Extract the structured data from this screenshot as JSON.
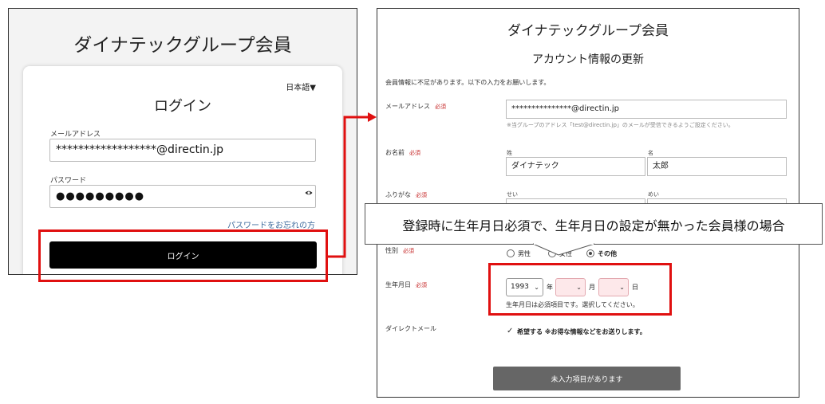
{
  "login_screen": {
    "title": "ダイナテックグループ会員",
    "language_selector": "日本語▼",
    "heading": "ログイン",
    "email_label": "メールアドレス",
    "email_value": "******************@directin.jp",
    "password_label": "パスワード",
    "password_value": "●●●●●●●●●",
    "forgot_password_link": "パスワードをお忘れの方",
    "login_button": "ログイン"
  },
  "update_screen": {
    "title": "ダイナテックグループ会員",
    "heading": "アカウント情報の更新",
    "notice": "会員情報に不足があります。以下の入力をお願いします。",
    "required_badge": "必須",
    "email": {
      "label": "メールアドレス",
      "value": "***************@directin.jp",
      "hint": "※当グループのアドレス「test@directin.jp」のメールが受信できるようご設定ください。"
    },
    "name": {
      "label": "お名前",
      "last_name_label": "姓",
      "first_name_label": "名",
      "last_name_value": "ダイナテック",
      "first_name_value": "太郎"
    },
    "furigana": {
      "label": "ふりがな",
      "last_label": "せい",
      "first_label": "めい"
    },
    "gender": {
      "label": "性別",
      "options": [
        "男性",
        "女性",
        "その他"
      ],
      "selected": "その他"
    },
    "birthdate": {
      "label": "生年月日",
      "year_value": "1993",
      "year_unit": "年",
      "month_value": "",
      "month_unit": "月",
      "day_value": "",
      "day_unit": "日",
      "error_message": "生年月日は必須項目です。選択してください。"
    },
    "direct_mail": {
      "label": "ダイレクトメール",
      "checkbox_label": "希望する ※お得な情報などをお送りします。",
      "checked": true
    },
    "submit_button": "未入力項目があります"
  },
  "callout": {
    "text": "登録時に生年月日必須で、生年月日の設定が無かった会員様の場合"
  },
  "colors": {
    "highlight_red": "#e01010",
    "required_red": "#c62828",
    "link_blue": "#3f6c9d",
    "error_pink": "#fde8ea",
    "login_button": "#000000",
    "submit_disabled": "#666666"
  }
}
